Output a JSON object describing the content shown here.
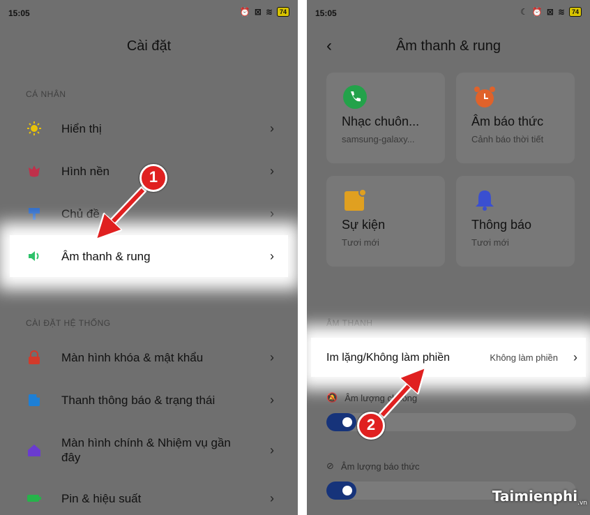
{
  "left_screen": {
    "status": {
      "time": "15:05",
      "battery": "74"
    },
    "title": "Cài đặt",
    "sections": {
      "personal": "CÁ NHÂN",
      "system": "CÀI ĐẶT HỆ THỐNG"
    },
    "items": [
      {
        "label": "Hiển thị",
        "icon": "sun-icon",
        "color": "#e8c20a"
      },
      {
        "label": "Hình nền",
        "icon": "flower-icon",
        "color": "#c0304a"
      },
      {
        "label": "Chủ đề",
        "icon": "paint-roller-icon",
        "color": "#2f6cc8"
      },
      {
        "label": "Âm thanh & rung",
        "icon": "speaker-icon",
        "color": "#2ec26a"
      },
      {
        "label": "Màn hình khóa & mật khẩu",
        "icon": "lock-icon",
        "color": "#d23a2a"
      },
      {
        "label": "Thanh thông báo & trạng thái",
        "icon": "notification-icon",
        "color": "#1d7fd6"
      },
      {
        "label": "Màn hình chính & Nhiệm vụ gần đây",
        "icon": "home-icon",
        "color": "#6a3bd0"
      },
      {
        "label": "Pin & hiệu suất",
        "icon": "battery-icon",
        "color": "#26b34a"
      }
    ]
  },
  "right_screen": {
    "status": {
      "time": "15:05",
      "battery": "74"
    },
    "title": "Âm thanh & rung",
    "cards": [
      {
        "name": "Nhạc chuôn...",
        "sub": "samsung-galaxy...",
        "icon": "phone-icon",
        "color": "#23a24a"
      },
      {
        "name": "Âm báo thức",
        "sub": "Cảnh báo thời tiết",
        "icon": "alarm-clock-icon",
        "color": "#e0622a"
      },
      {
        "name": "Sự kiện",
        "sub": "Tươi mới",
        "icon": "calendar-icon",
        "color": "#e0a020"
      },
      {
        "name": "Thông báo",
        "sub": "Tươi mới",
        "icon": "bell-icon",
        "color": "#3a4fd0"
      }
    ],
    "section": "ÂM THANH",
    "silent_row": {
      "label": "Im lặng/Không làm phiền",
      "value": "Không làm phiền"
    },
    "volume_1": {
      "label": "Âm lượng chuông",
      "level": 0.12
    },
    "volume_2": {
      "label": "Âm lượng báo thức",
      "level": 0.12
    }
  },
  "steps": [
    "1",
    "2"
  ],
  "watermark": {
    "brand": "Taimienphi",
    "suffix": ".vn"
  },
  "accent_colors": {
    "arrow": "#e02020",
    "highlight": "#ffffff",
    "slider": "#16337a"
  }
}
